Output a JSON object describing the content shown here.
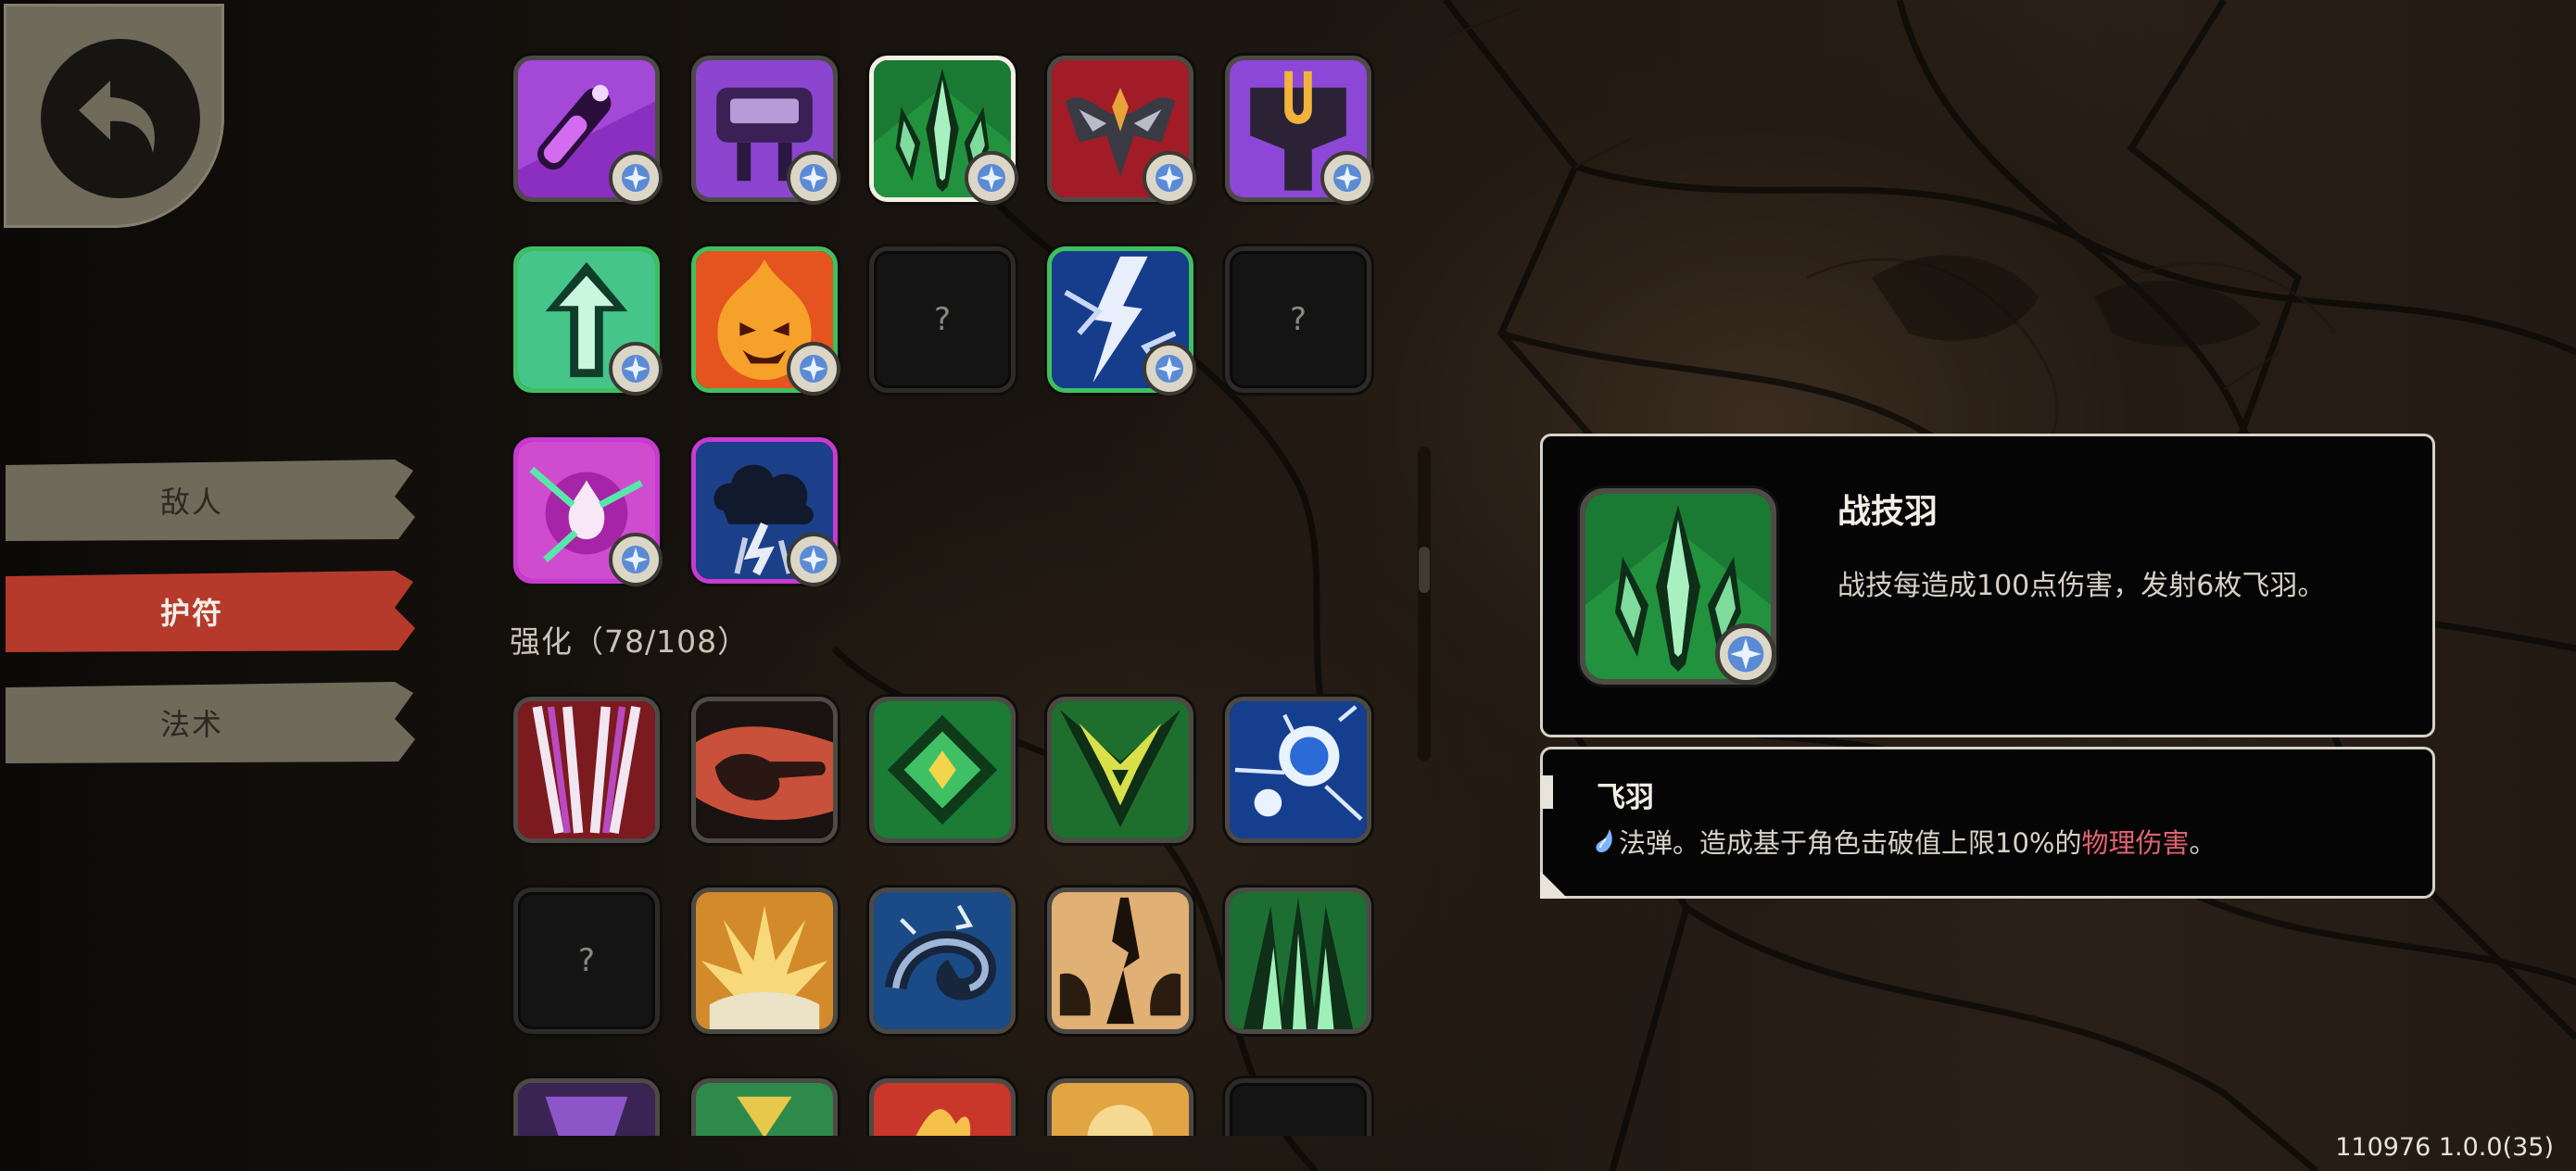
{
  "nav": {
    "back_icon": "back-arrow-icon",
    "tabs": [
      {
        "label": "敌人",
        "active": false
      },
      {
        "label": "护符",
        "active": true
      },
      {
        "label": "法术",
        "active": false
      }
    ],
    "colors": {
      "tab_inactive": "#6f6a5a",
      "tab_active": "#b53a2c"
    }
  },
  "collection": {
    "section_label": "强化（78/108）",
    "locked_mark": "?"
  },
  "detail": {
    "title": "战技羽",
    "description": "战技每造成100点伤害，发射6枚飞羽。"
  },
  "sub_detail": {
    "title": "飞羽",
    "text_prefix": "法弹。造成基于角色击破值上限10%的",
    "highlight": "物理伤害",
    "text_suffix": "。",
    "highlight_color": "#e0636d"
  },
  "version": "110976 1.0.0(35)"
}
